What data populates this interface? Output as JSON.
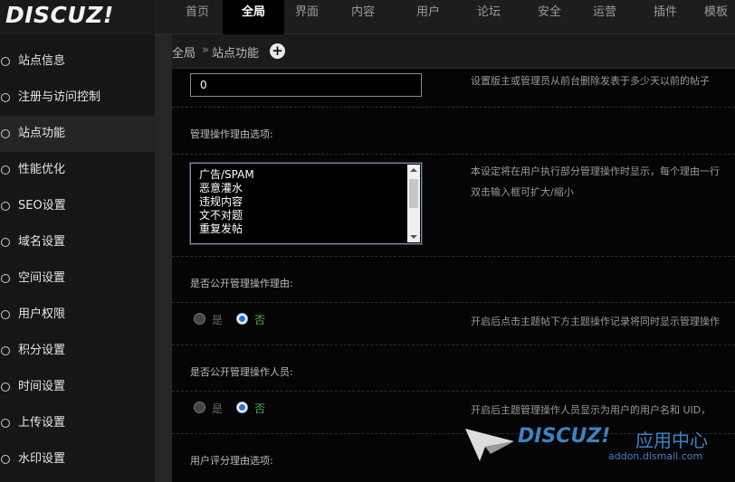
{
  "logo": "DISCUZ!",
  "nav": {
    "items": [
      {
        "label": "首页",
        "active": false
      },
      {
        "label": "全局",
        "active": true
      },
      {
        "label": "界面",
        "active": false
      },
      {
        "label": "内容",
        "active": false
      },
      {
        "label": "用户",
        "active": false
      },
      {
        "label": "论坛",
        "active": false
      },
      {
        "label": "安全",
        "active": false
      },
      {
        "label": "运营",
        "active": false
      },
      {
        "label": "插件",
        "active": false
      },
      {
        "label": "模板",
        "active": false
      }
    ]
  },
  "sidebar": {
    "items": [
      {
        "label": "站点信息"
      },
      {
        "label": "注册与访问控制"
      },
      {
        "label": "站点功能"
      },
      {
        "label": "性能优化"
      },
      {
        "label": "SEO设置"
      },
      {
        "label": "域名设置"
      },
      {
        "label": "空间设置"
      },
      {
        "label": "用户权限"
      },
      {
        "label": "积分设置"
      },
      {
        "label": "时间设置"
      },
      {
        "label": "上传设置"
      },
      {
        "label": "水印设置"
      }
    ]
  },
  "breadcrumb": {
    "root": "全局",
    "sep": "»",
    "current": "站点功能",
    "add_icon": "+"
  },
  "settings": {
    "days_input": {
      "value": "0",
      "desc": "设置版主或管理员从前台删除发表于多少天以前的帖子"
    },
    "reasons": {
      "title": "管理操作理由选项:",
      "lines": [
        "广告/SPAM",
        "恶意灌水",
        "违规内容",
        "文不对题",
        "重复发帖"
      ],
      "desc1": "本设定将在用户执行部分管理操作时显示，每个理由一行",
      "desc2": "双击输入框可扩大/缩小"
    },
    "public_reason": {
      "title": "是否公开管理操作理由:",
      "yes": "是",
      "no": "否",
      "desc": "开启后点击主题帖下方主题操作记录将同时显示管理操作"
    },
    "public_operator": {
      "title": "是否公开管理操作人员:",
      "yes": "是",
      "no": "否",
      "desc": "开启后主题管理操作人员显示为用户的用户名和 UID，"
    },
    "rate_reasons": {
      "title": "用户评分理由选项:"
    }
  },
  "watermark": {
    "brand": "DISCUZ!",
    "cn": "应用中心",
    "url": "addon.dismall.com"
  }
}
